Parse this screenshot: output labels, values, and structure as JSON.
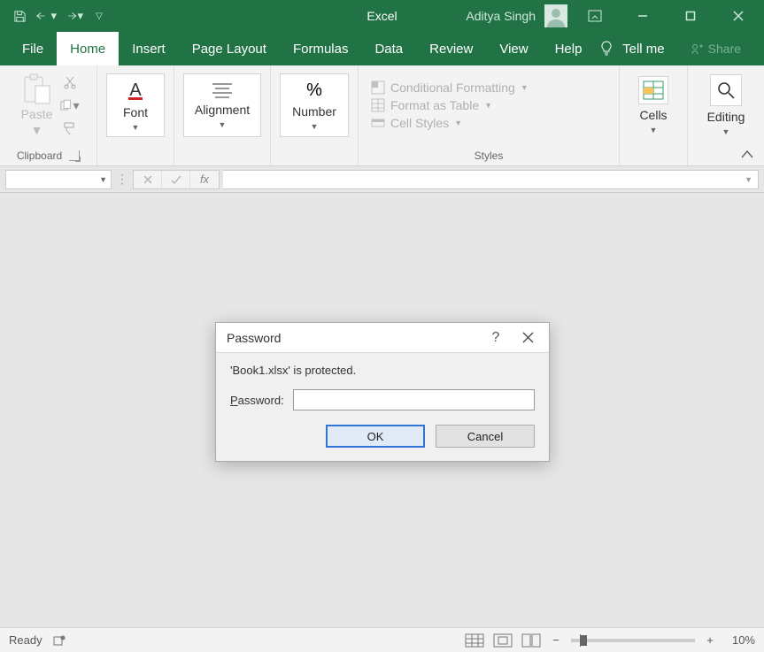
{
  "titlebar": {
    "app_name": "Excel",
    "user_name": "Aditya Singh"
  },
  "tabs": {
    "file": "File",
    "home": "Home",
    "insert": "Insert",
    "pagelayout": "Page Layout",
    "formulas": "Formulas",
    "data": "Data",
    "review": "Review",
    "view": "View",
    "help": "Help",
    "tellme": "Tell me",
    "share": "Share"
  },
  "ribbon": {
    "clipboard": {
      "label": "Clipboard",
      "paste": "Paste"
    },
    "font": {
      "label": "Font"
    },
    "alignment": {
      "label": "Alignment"
    },
    "number": {
      "label": "Number"
    },
    "styles": {
      "label": "Styles",
      "cond": "Conditional Formatting",
      "table": "Format as Table",
      "cell": "Cell Styles"
    },
    "cells": {
      "label": "Cells"
    },
    "editing": {
      "label": "Editing"
    }
  },
  "dialog": {
    "title": "Password",
    "message": "'Book1.xlsx' is protected.",
    "field_label_prefix": "P",
    "field_label_rest": "assword:",
    "ok": "OK",
    "cancel": "Cancel"
  },
  "statusbar": {
    "ready": "Ready",
    "zoom": "10%"
  }
}
